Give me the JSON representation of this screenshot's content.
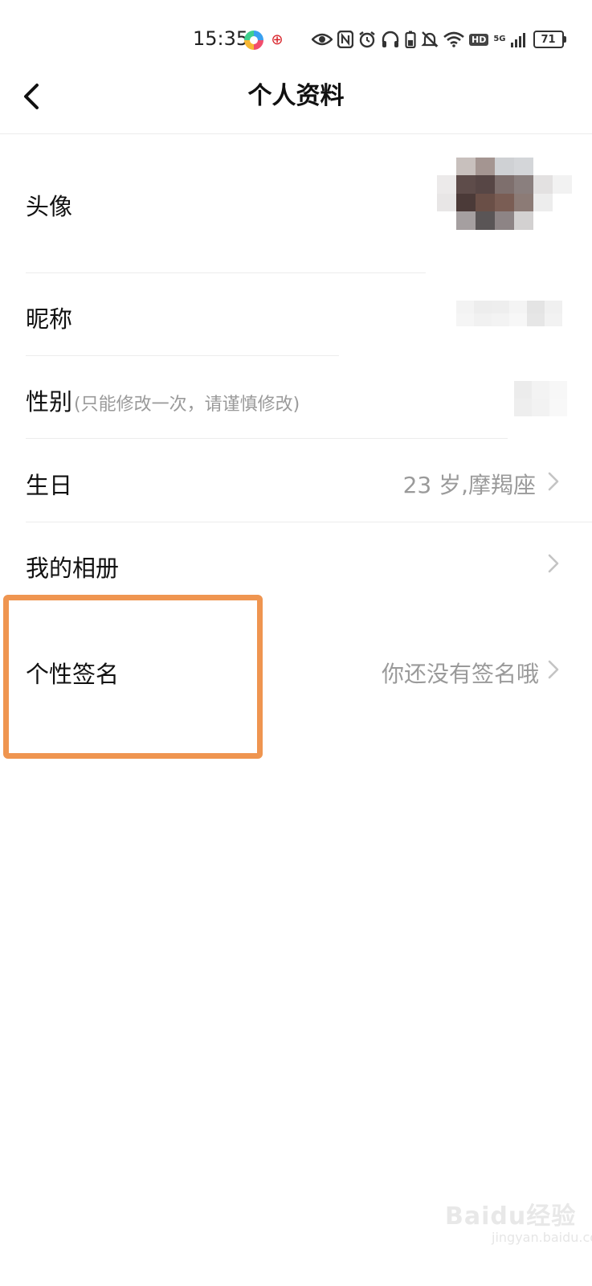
{
  "status_bar": {
    "time": "15:35",
    "battery": "71",
    "network": "5G",
    "hd": "HD",
    "icons": [
      "app-logo-icon",
      "carrier-logo-icon",
      "eye-icon",
      "nfc-icon",
      "alarm-icon",
      "headphones-icon",
      "battery-saver-icon",
      "mute-icon",
      "wifi-icon",
      "hd-icon",
      "signal-icon",
      "battery-icon"
    ]
  },
  "header": {
    "title": "个人资料"
  },
  "rows": {
    "avatar": {
      "label": "头像"
    },
    "nickname": {
      "label": "昵称"
    },
    "gender": {
      "label": "性别",
      "hint": "(只能修改一次，请谨慎修改)"
    },
    "birthday": {
      "label": "生日",
      "value": "23 岁,摩羯座"
    },
    "album": {
      "label": "我的相册"
    },
    "signature": {
      "label": "个性签名",
      "value": "你还没有签名哦"
    }
  },
  "highlight": {
    "color": "#ef9550"
  },
  "watermark": {
    "text": "Baidu经验",
    "sub": "jingyan.baidu.com"
  },
  "colors": {
    "divider": "#ececec",
    "secondary_text": "#9a9a9a",
    "primary_text": "#111111"
  }
}
